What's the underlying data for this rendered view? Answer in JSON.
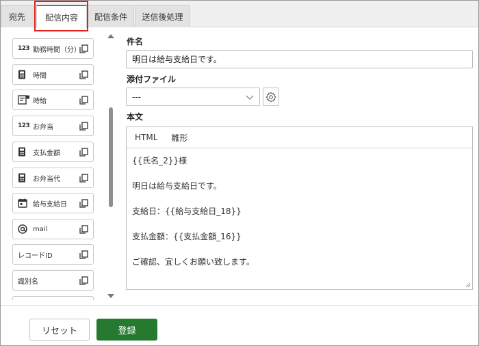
{
  "tabs": [
    {
      "label": "宛先"
    },
    {
      "label": "配信内容"
    },
    {
      "label": "配信条件"
    },
    {
      "label": "送信後処理"
    }
  ],
  "active_tab": "配信内容",
  "palette": {
    "items": [
      {
        "label": "勤務時間（分）",
        "icon": "number-icon",
        "badge": "123"
      },
      {
        "label": "時間",
        "icon": "calculator-icon"
      },
      {
        "label": "時給",
        "icon": "form-icon"
      },
      {
        "label": "お弁当",
        "icon": "number-icon",
        "badge": "123"
      },
      {
        "label": "支払金額",
        "icon": "calculator-icon"
      },
      {
        "label": "お弁当代",
        "icon": "calculator-icon"
      },
      {
        "label": "給与支給日",
        "icon": "calendar-icon"
      },
      {
        "label": "mail",
        "icon": "at-icon"
      },
      {
        "label": "レコードID",
        "icon": ""
      },
      {
        "label": "識別名",
        "icon": ""
      }
    ]
  },
  "form": {
    "subject_label": "件名",
    "subject_value": "明日は給与支給日です。",
    "attachment_label": "添付ファイル",
    "attachment_value": "---",
    "body_label": "本文",
    "editor_tabs": [
      {
        "label": "HTML"
      },
      {
        "label": "雛形"
      }
    ],
    "body_lines": [
      "{{氏名_2}}様",
      "明日は給与支給日です。",
      "支給日：{{給与支給日_18}}",
      "支払金額：{{支払金額_16}}",
      "ご確認、宜しくお願い致します。"
    ]
  },
  "buttons": {
    "reset": "リセット",
    "save": "登録"
  },
  "colors": {
    "active_tab_accent": "#2f7fd1",
    "highlight": "#e0201c",
    "save_button": "#267a30"
  }
}
